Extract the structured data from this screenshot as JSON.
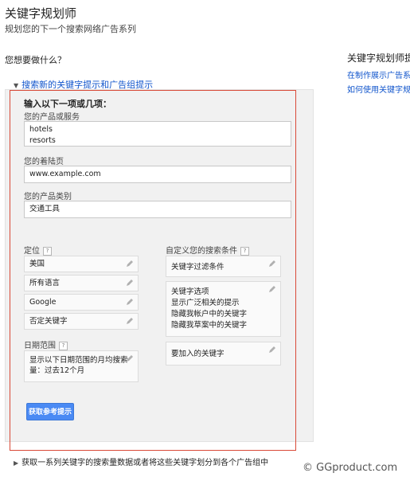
{
  "header": {
    "title": "关键字规划师",
    "subtitle": "规划您的下一个搜索网络广告系列"
  },
  "question": "您想要做什么？",
  "sidebar": {
    "title": "关键字规划师提",
    "links": [
      "在制作展示广告系列",
      "如何使用关键字规划"
    ]
  },
  "section": {
    "header": "搜索新的关键字提示和广告组提示",
    "intro": "输入以下一项或几项：",
    "product_label": "您的产品或服务",
    "product_lines": [
      "hotels",
      "resorts"
    ],
    "landing_label": "您的着陆页",
    "landing_value": "www.example.com",
    "category_label": "您的产品类别",
    "category_value": "交通工具",
    "targeting": {
      "label": "定位",
      "help": "?",
      "items": [
        "美国",
        "所有语言",
        "Google",
        "否定关键字"
      ]
    },
    "date_range": {
      "label": "日期范围",
      "help": "?",
      "lines": [
        "显示以下日期范围的月均搜索",
        "量：过去12个月"
      ]
    },
    "custom": {
      "label": "自定义您的搜索条件",
      "help": "?",
      "keyword_filter": "关键字过滤条件",
      "keyword_options_title": "关键字选项",
      "keyword_options_lines": [
        "显示广泛相关的提示",
        "隐藏我帐户中的关键字",
        "隐藏我草案中的关键字"
      ],
      "include_keywords": "要加入的关键字"
    },
    "submit": "获取参考提示"
  },
  "bottom_link": "获取一系列关键字的搜索量数据或者将这些关键字划分到各个广告组中",
  "watermark": "© GGproduct.com",
  "colors": {
    "link": "#1155cc",
    "button": "#4a8af4",
    "highlight": "#d94a38"
  }
}
